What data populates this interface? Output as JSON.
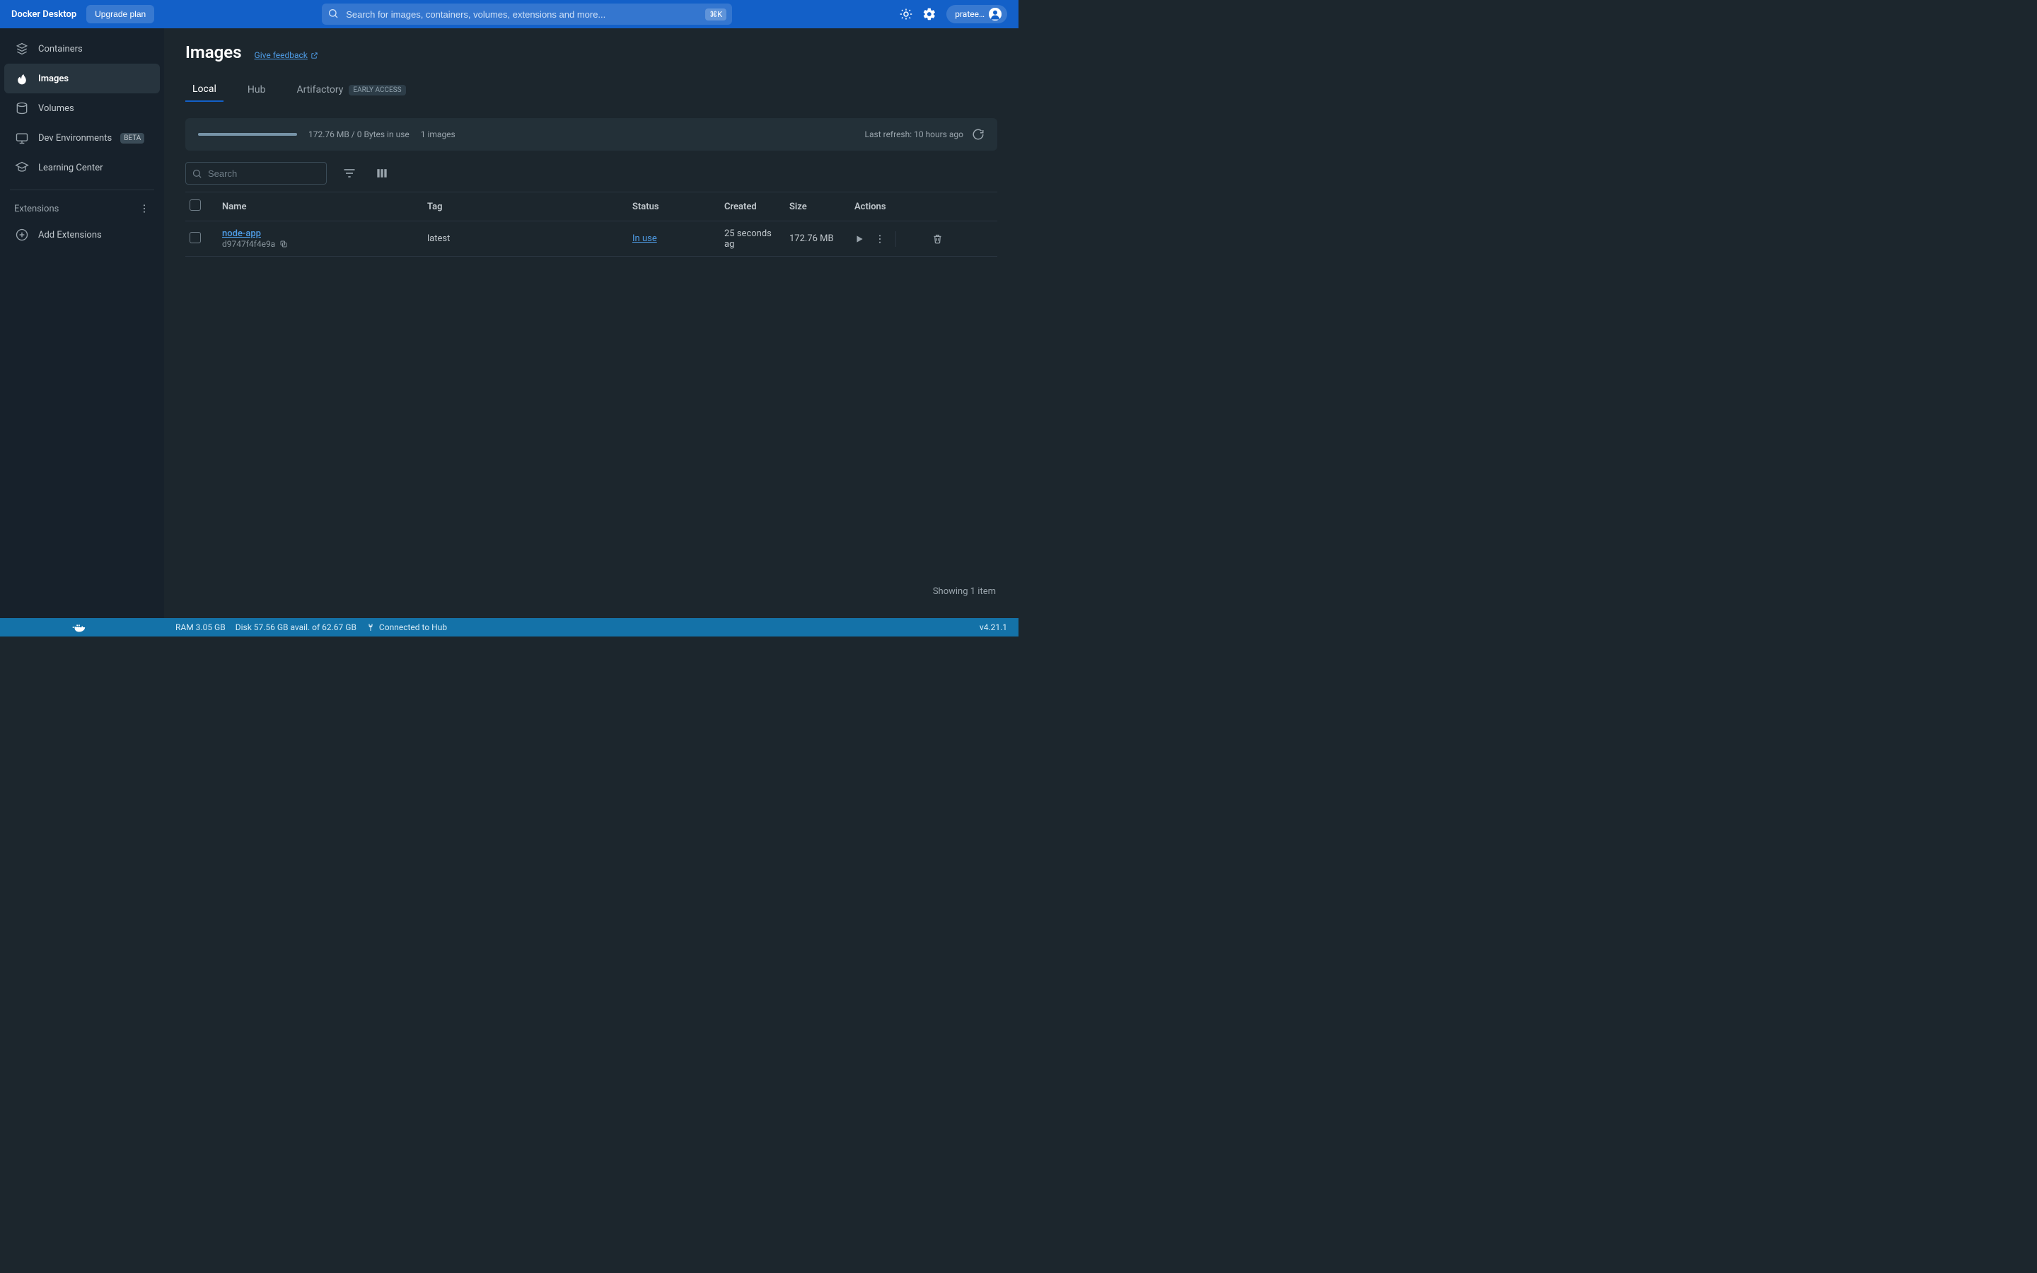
{
  "topbar": {
    "brand": "Docker Desktop",
    "upgrade_label": "Upgrade plan",
    "search_placeholder": "Search for images, containers, volumes, extensions and more...",
    "search_shortcut": "⌘K",
    "username": "pratee…"
  },
  "sidebar": {
    "items": [
      {
        "label": "Containers",
        "icon": "containers-icon"
      },
      {
        "label": "Images",
        "icon": "images-icon",
        "active": true
      },
      {
        "label": "Volumes",
        "icon": "volumes-icon"
      },
      {
        "label": "Dev Environments",
        "icon": "dev-env-icon",
        "badge": "BETA"
      },
      {
        "label": "Learning Center",
        "icon": "learning-icon"
      }
    ],
    "extensions_header": "Extensions",
    "add_extensions": "Add Extensions"
  },
  "page": {
    "title": "Images",
    "feedback": "Give feedback"
  },
  "tabs": {
    "local": "Local",
    "hub": "Hub",
    "artifactory": "Artifactory",
    "artifactory_badge": "EARLY ACCESS"
  },
  "usage": {
    "summary": "172.76 MB / 0 Bytes in use",
    "count": "1 images",
    "last_refresh": "Last refresh: 10 hours ago"
  },
  "toolbar": {
    "search_placeholder": "Search"
  },
  "table": {
    "headers": {
      "name": "Name",
      "tag": "Tag",
      "status": "Status",
      "created": "Created",
      "size": "Size",
      "actions": "Actions"
    },
    "rows": [
      {
        "name": "node-app",
        "id": "d9747f4f4e9a",
        "tag": "latest",
        "status": "In use",
        "created": "25 seconds ag",
        "size": "172.76 MB"
      }
    ],
    "footer": "Showing 1 item"
  },
  "statusbar": {
    "ram": "RAM 3.05 GB",
    "disk": "Disk 57.56 GB avail. of 62.67 GB",
    "connection": "Connected to Hub",
    "version": "v4.21.1"
  }
}
